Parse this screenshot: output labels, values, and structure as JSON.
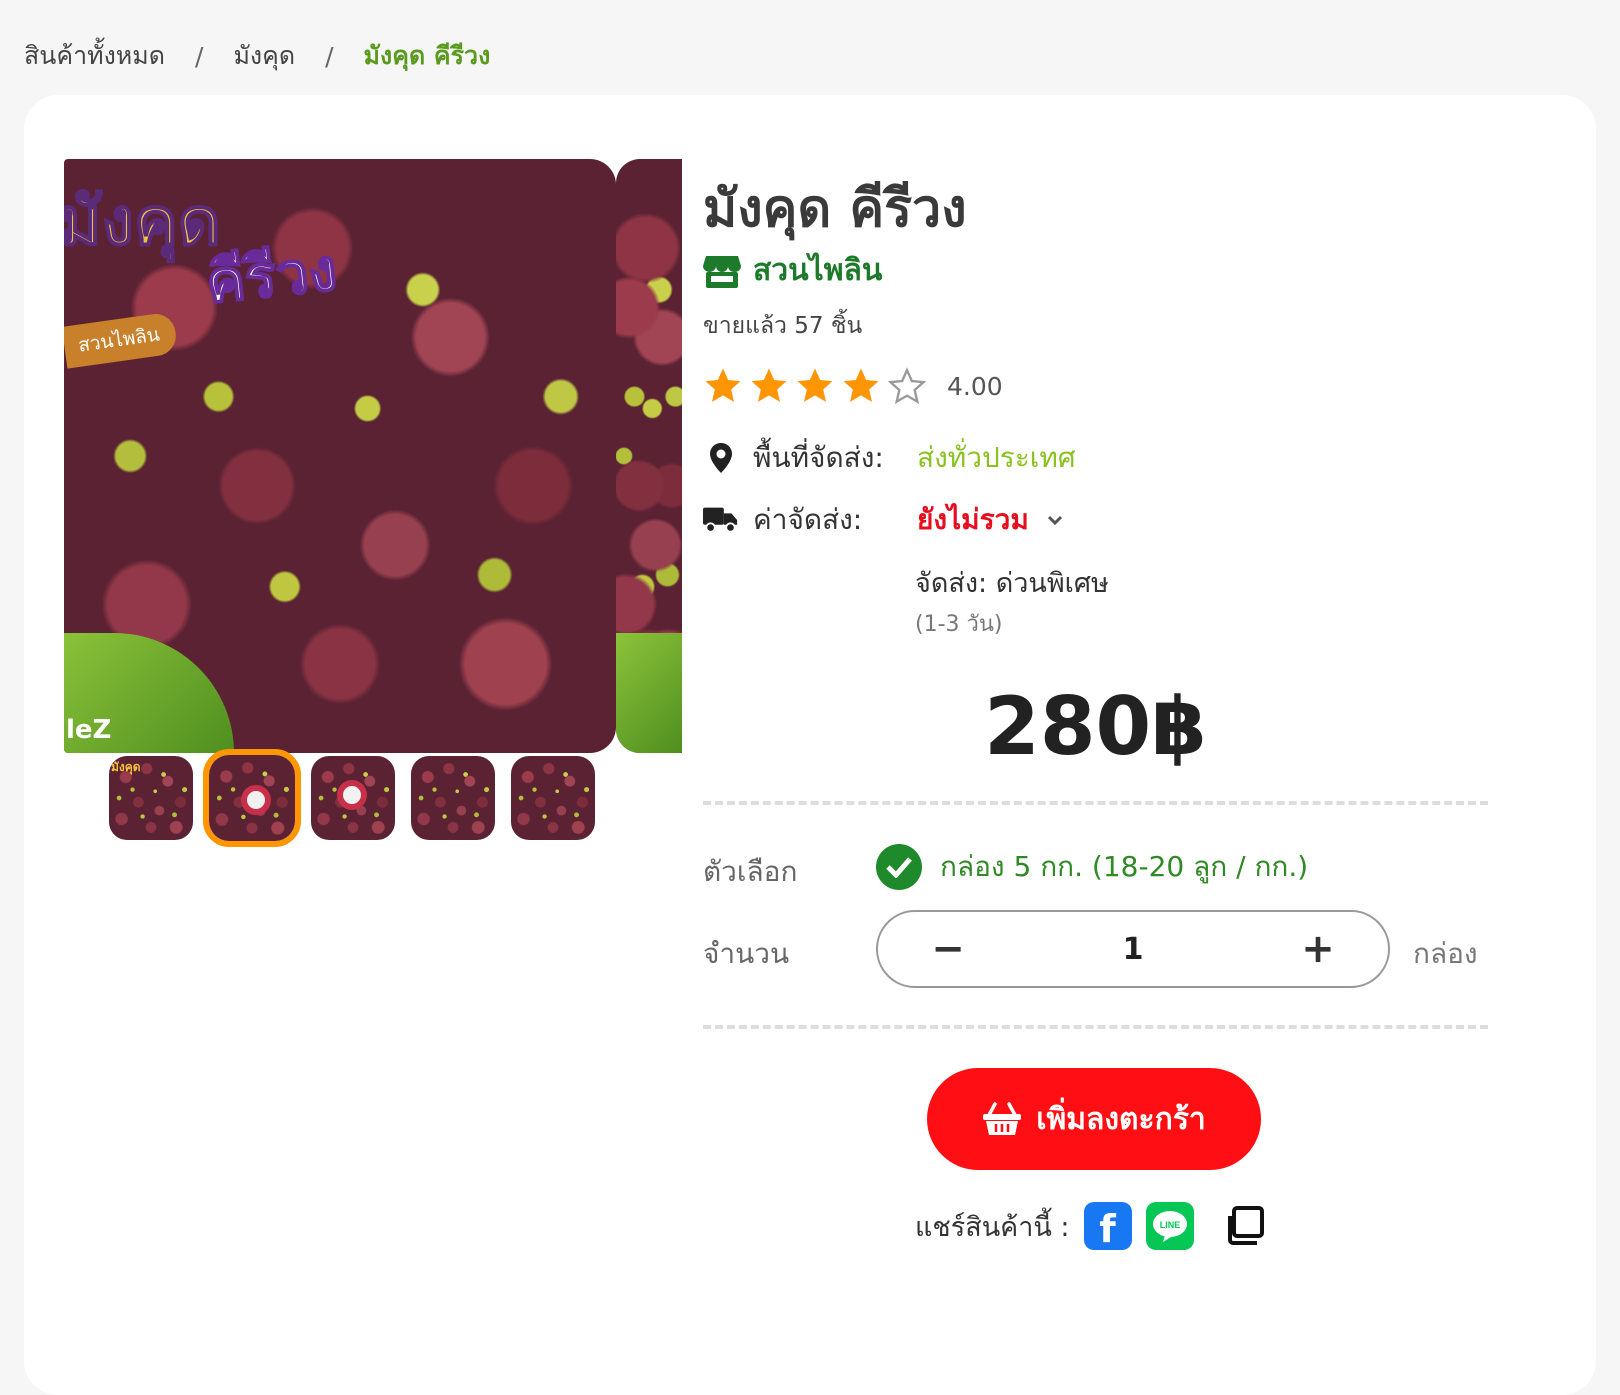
{
  "breadcrumb": {
    "all": "สินค้าทั้งหมด",
    "category": "มังคุด",
    "current": "มังคุด คีรีวง",
    "separator": "/"
  },
  "gallery": {
    "main_image": {
      "title_line1": "มังคุด",
      "title_line2": "คีรีวง",
      "tag": "สวนไพลิน",
      "brand": "leZ"
    },
    "thumbnail_count": 5,
    "active_thumbnail_index": 1,
    "thumb0_label": "มังคุด"
  },
  "product": {
    "name": "มังคุด คีรีวง",
    "shop": "สวนไพลิน",
    "sold": "ขายแล้ว 57 ชิ้น",
    "rating_value": "4.00",
    "rating_stars": 4,
    "rating_max": 5
  },
  "shipping": {
    "area_label": "พื้นที่จัดส่ง:",
    "area_value": "ส่งทั่วประเทศ",
    "fee_label": "ค่าจัดส่ง:",
    "fee_value": "ยังไม่รวม",
    "method": "จัดส่ง: ด่วนพิเศษ",
    "days": "(1-3 วัน)"
  },
  "price": "280฿",
  "options": {
    "label": "ตัวเลือก",
    "selected": "กล่อง 5 กก. (18-20 ลูก / กก.)"
  },
  "quantity": {
    "label": "จำนวน",
    "minus": "−",
    "value": "1",
    "plus": "+",
    "unit": "กล่อง"
  },
  "add_to_cart": "เพิ่มลงตะกร้า",
  "share": {
    "label": "แชร์สินค้านี้ :",
    "facebook": "f",
    "line": "LINE"
  },
  "colors": {
    "accent_green": "#5a9a1d",
    "shop_green": "#1e7a2b",
    "area_green": "#89c21c",
    "fee_red": "#e60e1e",
    "cart_red": "#ff0f13",
    "star_orange": "#ff9500",
    "thumb_active": "#ff9500"
  },
  "icons": {
    "shop": "store-icon",
    "area": "map-pin-icon",
    "fee": "truck-icon",
    "fee_toggle": "chevron-down-icon",
    "option": "check-circle-icon",
    "cart": "basket-icon",
    "share_fb": "facebook-icon",
    "share_line": "line-icon",
    "share_copy": "copy-icon"
  }
}
